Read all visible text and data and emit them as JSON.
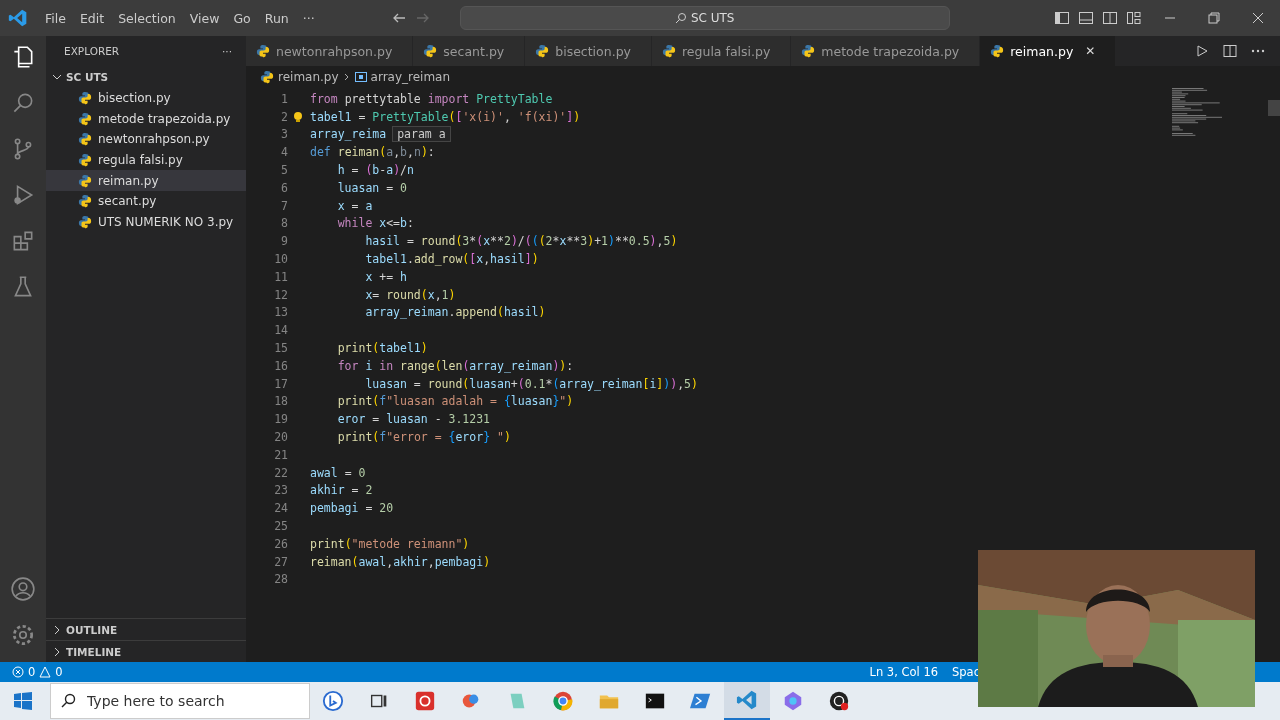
{
  "menu": [
    "File",
    "Edit",
    "Selection",
    "View",
    "Go",
    "Run",
    "···"
  ],
  "command_center": {
    "value": "SC UTS"
  },
  "explorer": {
    "title": "EXPLORER",
    "more": "···",
    "folder": "SC UTS",
    "expanded": true,
    "files": [
      {
        "name": "bisection.py",
        "selected": false
      },
      {
        "name": "metode trapezoida.py",
        "selected": false
      },
      {
        "name": "newtonrahpson.py",
        "selected": false
      },
      {
        "name": "regula falsi.py",
        "selected": false
      },
      {
        "name": "reiman.py",
        "selected": true
      },
      {
        "name": "secant.py",
        "selected": false
      },
      {
        "name": "UTS NUMERIK NO 3.py",
        "selected": false
      }
    ],
    "sections": [
      {
        "name": "OUTLINE",
        "expanded": false
      },
      {
        "name": "TIMELINE",
        "expanded": false
      }
    ]
  },
  "tabs": [
    {
      "name": "newtonrahpson.py",
      "selected": false
    },
    {
      "name": "secant.py",
      "selected": false
    },
    {
      "name": "bisection.py",
      "selected": false
    },
    {
      "name": "regula falsi.py",
      "selected": false
    },
    {
      "name": "metode trapezoida.py",
      "selected": false
    },
    {
      "name": "reiman.py",
      "selected": true,
      "close": "✕"
    }
  ],
  "breadcrumb": [
    "reiman.py",
    "array_reiman"
  ],
  "code": [
    {
      "number": "1",
      "tokens": [
        {
          "kind": "k",
          "text": "from"
        },
        {
          "kind": "p",
          "text": " prettytable "
        },
        {
          "kind": "k",
          "text": "import"
        },
        {
          "kind": "c",
          "text": " PrettyTable"
        }
      ]
    },
    {
      "number": "2",
      "lightbulb": true,
      "tokens": [
        {
          "kind": "v",
          "text": "tabel1"
        },
        {
          "kind": "p",
          "text": " = "
        },
        {
          "kind": "c",
          "text": "PrettyTable"
        },
        {
          "kind": "b",
          "text": "("
        },
        {
          "kind": "b2",
          "text": "["
        },
        {
          "kind": "s",
          "text": "'x(i)'"
        },
        {
          "kind": "p",
          "text": ", "
        },
        {
          "kind": "s",
          "text": "'f(xi)'"
        },
        {
          "kind": "b2",
          "text": "]"
        },
        {
          "kind": "b",
          "text": ")"
        }
      ]
    },
    {
      "number": "3",
      "tooltip": "param a",
      "tokens": [
        {
          "kind": "v",
          "text": "array_reima"
        }
      ]
    },
    {
      "number": "4",
      "tokens": [
        {
          "kind": "d",
          "text": "def"
        },
        {
          "kind": "f",
          "text": " reiman"
        },
        {
          "kind": "b",
          "text": "("
        },
        {
          "kind": "x",
          "text": "a"
        },
        {
          "kind": "p",
          "text": ","
        },
        {
          "kind": "x",
          "text": "b"
        },
        {
          "kind": "p",
          "text": ","
        },
        {
          "kind": "x",
          "text": "n"
        },
        {
          "kind": "b",
          "text": ")"
        },
        {
          "kind": "p",
          "text": ":"
        }
      ]
    },
    {
      "number": "5",
      "tokens": [
        {
          "kind": "v",
          "text": "    h"
        },
        {
          "kind": "p",
          "text": " = "
        },
        {
          "kind": "b2",
          "text": "("
        },
        {
          "kind": "v",
          "text": "b"
        },
        {
          "kind": "p",
          "text": "-"
        },
        {
          "kind": "v",
          "text": "a"
        },
        {
          "kind": "b2",
          "text": ")"
        },
        {
          "kind": "p",
          "text": "/"
        },
        {
          "kind": "v",
          "text": "n"
        }
      ]
    },
    {
      "number": "6",
      "tokens": [
        {
          "kind": "v",
          "text": "    luasan"
        },
        {
          "kind": "p",
          "text": " = "
        },
        {
          "kind": "n",
          "text": "0"
        }
      ]
    },
    {
      "number": "7",
      "tokens": [
        {
          "kind": "v",
          "text": "    x"
        },
        {
          "kind": "p",
          "text": " = "
        },
        {
          "kind": "v",
          "text": "a"
        }
      ]
    },
    {
      "number": "8",
      "tokens": [
        {
          "kind": "k",
          "text": "    while"
        },
        {
          "kind": "v",
          "text": " x"
        },
        {
          "kind": "p",
          "text": "<="
        },
        {
          "kind": "v",
          "text": "b"
        },
        {
          "kind": "p",
          "text": ":"
        }
      ]
    },
    {
      "number": "9",
      "tokens": [
        {
          "kind": "v",
          "text": "        hasil"
        },
        {
          "kind": "p",
          "text": " = "
        },
        {
          "kind": "f",
          "text": "round"
        },
        {
          "kind": "b",
          "text": "("
        },
        {
          "kind": "n",
          "text": "3"
        },
        {
          "kind": "p",
          "text": "*"
        },
        {
          "kind": "b2",
          "text": "("
        },
        {
          "kind": "v",
          "text": "x"
        },
        {
          "kind": "p",
          "text": "**"
        },
        {
          "kind": "n",
          "text": "2"
        },
        {
          "kind": "b2",
          "text": ")"
        },
        {
          "kind": "p",
          "text": "/"
        },
        {
          "kind": "b2",
          "text": "("
        },
        {
          "kind": "b3",
          "text": "("
        },
        {
          "kind": "b",
          "text": "("
        },
        {
          "kind": "n",
          "text": "2"
        },
        {
          "kind": "p",
          "text": "*"
        },
        {
          "kind": "v",
          "text": "x"
        },
        {
          "kind": "p",
          "text": "**"
        },
        {
          "kind": "n",
          "text": "3"
        },
        {
          "kind": "b",
          "text": ")"
        },
        {
          "kind": "p",
          "text": "+"
        },
        {
          "kind": "n",
          "text": "1"
        },
        {
          "kind": "b3",
          "text": ")"
        },
        {
          "kind": "p",
          "text": "**"
        },
        {
          "kind": "n",
          "text": "0.5"
        },
        {
          "kind": "b2",
          "text": ")"
        },
        {
          "kind": "p",
          "text": ","
        },
        {
          "kind": "n",
          "text": "5"
        },
        {
          "kind": "b",
          "text": ")"
        }
      ]
    },
    {
      "number": "10",
      "tokens": [
        {
          "kind": "v",
          "text": "        tabel1"
        },
        {
          "kind": "p",
          "text": "."
        },
        {
          "kind": "f",
          "text": "add_row"
        },
        {
          "kind": "b",
          "text": "("
        },
        {
          "kind": "b2",
          "text": "["
        },
        {
          "kind": "v",
          "text": "x"
        },
        {
          "kind": "p",
          "text": ","
        },
        {
          "kind": "v",
          "text": "hasil"
        },
        {
          "kind": "b2",
          "text": "]"
        },
        {
          "kind": "b",
          "text": ")"
        }
      ]
    },
    {
      "number": "11",
      "tokens": [
        {
          "kind": "v",
          "text": "        x"
        },
        {
          "kind": "p",
          "text": " += "
        },
        {
          "kind": "v",
          "text": "h"
        }
      ]
    },
    {
      "number": "12",
      "tokens": [
        {
          "kind": "v",
          "text": "        x"
        },
        {
          "kind": "p",
          "text": "= "
        },
        {
          "kind": "f",
          "text": "round"
        },
        {
          "kind": "b",
          "text": "("
        },
        {
          "kind": "v",
          "text": "x"
        },
        {
          "kind": "p",
          "text": ","
        },
        {
          "kind": "n",
          "text": "1"
        },
        {
          "kind": "b",
          "text": ")"
        }
      ]
    },
    {
      "number": "13",
      "tokens": [
        {
          "kind": "v",
          "text": "        array_reiman"
        },
        {
          "kind": "p",
          "text": "."
        },
        {
          "kind": "f",
          "text": "append"
        },
        {
          "kind": "b",
          "text": "("
        },
        {
          "kind": "v",
          "text": "hasil"
        },
        {
          "kind": "b",
          "text": ")"
        }
      ]
    },
    {
      "number": "14"
    },
    {
      "number": "15",
      "tokens": [
        {
          "kind": "f",
          "text": "    print"
        },
        {
          "kind": "b",
          "text": "("
        },
        {
          "kind": "v",
          "text": "tabel1"
        },
        {
          "kind": "b",
          "text": ")"
        }
      ]
    },
    {
      "number": "16",
      "tokens": [
        {
          "kind": "k",
          "text": "    for"
        },
        {
          "kind": "v",
          "text": " i "
        },
        {
          "kind": "k",
          "text": "in"
        },
        {
          "kind": "f",
          "text": " range"
        },
        {
          "kind": "b",
          "text": "("
        },
        {
          "kind": "f",
          "text": "len"
        },
        {
          "kind": "b2",
          "text": "("
        },
        {
          "kind": "v",
          "text": "array_reiman"
        },
        {
          "kind": "b2",
          "text": ")"
        },
        {
          "kind": "b",
          "text": ")"
        },
        {
          "kind": "p",
          "text": ":"
        }
      ]
    },
    {
      "number": "17",
      "tokens": [
        {
          "kind": "v",
          "text": "        luasan"
        },
        {
          "kind": "p",
          "text": " = "
        },
        {
          "kind": "f",
          "text": "round"
        },
        {
          "kind": "b",
          "text": "("
        },
        {
          "kind": "v",
          "text": "luasan"
        },
        {
          "kind": "p",
          "text": "+"
        },
        {
          "kind": "b2",
          "text": "("
        },
        {
          "kind": "n",
          "text": "0.1"
        },
        {
          "kind": "p",
          "text": "*"
        },
        {
          "kind": "b3",
          "text": "("
        },
        {
          "kind": "v",
          "text": "array_reiman"
        },
        {
          "kind": "b",
          "text": "["
        },
        {
          "kind": "v",
          "text": "i"
        },
        {
          "kind": "b",
          "text": "]"
        },
        {
          "kind": "b3",
          "text": ")"
        },
        {
          "kind": "b2",
          "text": ")"
        },
        {
          "kind": "p",
          "text": ","
        },
        {
          "kind": "n",
          "text": "5"
        },
        {
          "kind": "b",
          "text": ")"
        }
      ]
    },
    {
      "number": "18",
      "tokens": [
        {
          "kind": "f",
          "text": "    print"
        },
        {
          "kind": "b",
          "text": "("
        },
        {
          "kind": "d",
          "text": "f"
        },
        {
          "kind": "s",
          "text": "\"luasan adalah = "
        },
        {
          "kind": "b3",
          "text": "{"
        },
        {
          "kind": "v",
          "text": "luasan"
        },
        {
          "kind": "b3",
          "text": "}"
        },
        {
          "kind": "s",
          "text": "\""
        },
        {
          "kind": "b",
          "text": ")"
        }
      ]
    },
    {
      "number": "19",
      "tokens": [
        {
          "kind": "v",
          "text": "    eror"
        },
        {
          "kind": "p",
          "text": " = "
        },
        {
          "kind": "v",
          "text": "luasan"
        },
        {
          "kind": "p",
          "text": " - "
        },
        {
          "kind": "n",
          "text": "3.1231"
        }
      ]
    },
    {
      "number": "20",
      "tokens": [
        {
          "kind": "f",
          "text": "    print"
        },
        {
          "kind": "b",
          "text": "("
        },
        {
          "kind": "d",
          "text": "f"
        },
        {
          "kind": "s",
          "text": "\"error = "
        },
        {
          "kind": "b3",
          "text": "{"
        },
        {
          "kind": "v",
          "text": "eror"
        },
        {
          "kind": "b3",
          "text": "}"
        },
        {
          "kind": "s",
          "text": " \""
        },
        {
          "kind": "b",
          "text": ")"
        }
      ]
    },
    {
      "number": "21"
    },
    {
      "number": "22",
      "tokens": [
        {
          "kind": "v",
          "text": "awal"
        },
        {
          "kind": "p",
          "text": " = "
        },
        {
          "kind": "n",
          "text": "0"
        }
      ]
    },
    {
      "number": "23",
      "tokens": [
        {
          "kind": "v",
          "text": "akhir"
        },
        {
          "kind": "p",
          "text": " = "
        },
        {
          "kind": "n",
          "text": "2"
        }
      ]
    },
    {
      "number": "24",
      "tokens": [
        {
          "kind": "v",
          "text": "pembagi"
        },
        {
          "kind": "p",
          "text": " = "
        },
        {
          "kind": "n",
          "text": "20"
        }
      ]
    },
    {
      "number": "25"
    },
    {
      "number": "26",
      "tokens": [
        {
          "kind": "f",
          "text": "print"
        },
        {
          "kind": "b",
          "text": "("
        },
        {
          "kind": "s",
          "text": "\"metode reimann\""
        },
        {
          "kind": "b",
          "text": ")"
        }
      ]
    },
    {
      "number": "27",
      "tokens": [
        {
          "kind": "f",
          "text": "reiman"
        },
        {
          "kind": "b",
          "text": "("
        },
        {
          "kind": "v",
          "text": "awal"
        },
        {
          "kind": "p",
          "text": ","
        },
        {
          "kind": "v",
          "text": "akhir"
        },
        {
          "kind": "p",
          "text": ","
        },
        {
          "kind": "v",
          "text": "pembagi"
        },
        {
          "kind": "b",
          "text": ")"
        }
      ]
    },
    {
      "number": "28"
    }
  ],
  "status_bar": {
    "errors": "0",
    "warnings": "0",
    "position": "Ln 3, Col 16",
    "indent": "Spac"
  },
  "taskbar": {
    "search_placeholder": "Type here to search",
    "apps": [
      {
        "kind": "bing"
      },
      {
        "kind": "taskview"
      },
      {
        "kind": "red"
      },
      {
        "kind": "paint"
      },
      {
        "kind": "notes"
      },
      {
        "kind": "chrome"
      },
      {
        "kind": "folder"
      },
      {
        "kind": "terminal"
      },
      {
        "kind": "powershell"
      },
      {
        "kind": "vscode",
        "selected": true
      },
      {
        "kind": "copilot"
      },
      {
        "kind": "obs"
      }
    ]
  },
  "webcam": {
    "kind": "picture"
  }
}
